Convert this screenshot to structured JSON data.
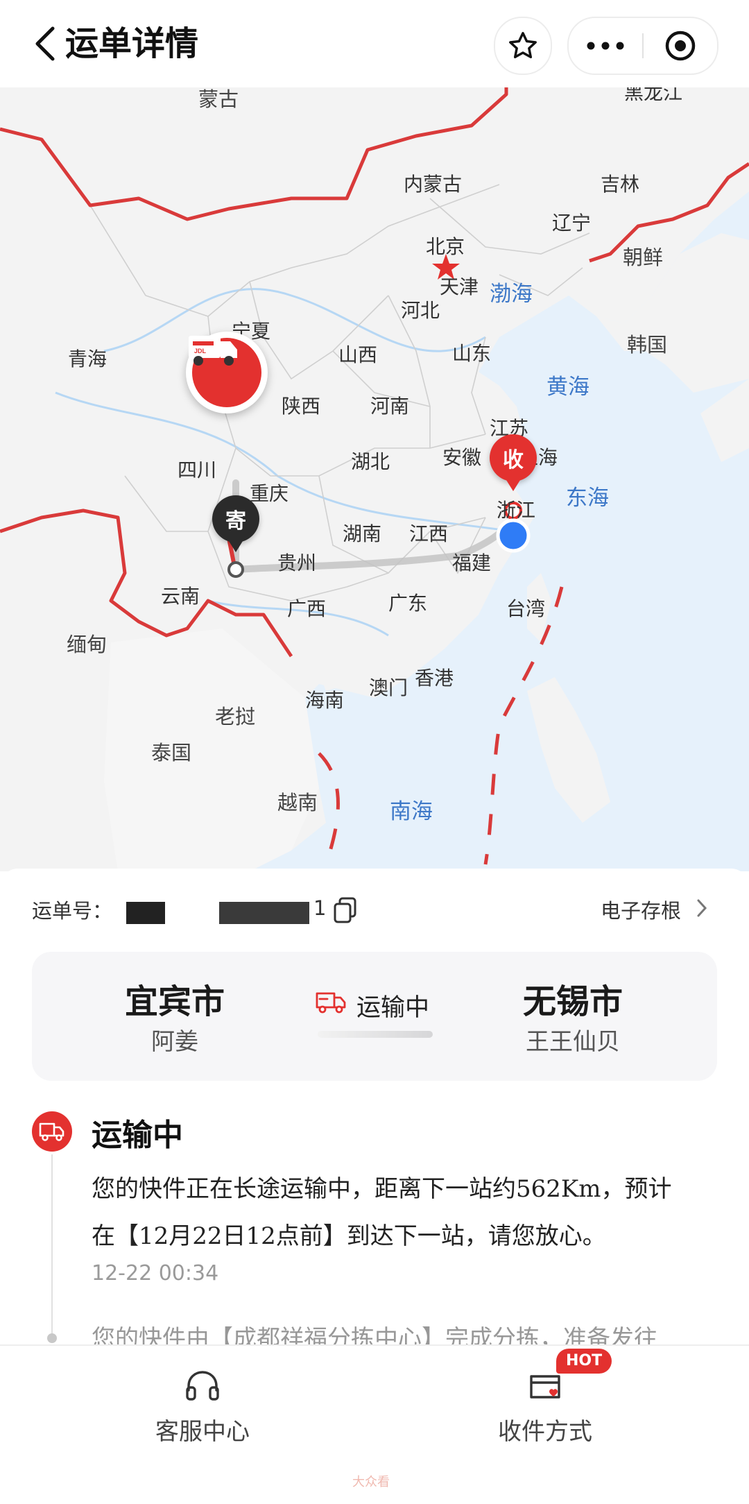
{
  "header": {
    "title": "运单详情",
    "icons": {
      "back": "chevron-left-icon",
      "favorite": "star-icon",
      "more": "more-dots-icon",
      "close": "target-close-icon"
    }
  },
  "map": {
    "provinces": [
      {
        "name": "蒙古",
        "kind": "country"
      },
      {
        "name": "黑龙江",
        "kind": "province"
      },
      {
        "name": "内蒙古",
        "kind": "province"
      },
      {
        "name": "吉林",
        "kind": "province"
      },
      {
        "name": "辽宁",
        "kind": "province"
      },
      {
        "name": "北京",
        "kind": "province"
      },
      {
        "name": "天津",
        "kind": "province"
      },
      {
        "name": "渤海",
        "kind": "sea"
      },
      {
        "name": "朝鲜",
        "kind": "country"
      },
      {
        "name": "宁夏",
        "kind": "province"
      },
      {
        "name": "河北",
        "kind": "province"
      },
      {
        "name": "青海",
        "kind": "province"
      },
      {
        "name": "山西",
        "kind": "province"
      },
      {
        "name": "山东",
        "kind": "province"
      },
      {
        "name": "韩国",
        "kind": "country"
      },
      {
        "name": "黄海",
        "kind": "sea"
      },
      {
        "name": "陕西",
        "kind": "province"
      },
      {
        "name": "河南",
        "kind": "province"
      },
      {
        "name": "江苏",
        "kind": "province"
      },
      {
        "name": "四川",
        "kind": "province"
      },
      {
        "name": "湖北",
        "kind": "province"
      },
      {
        "name": "安徽",
        "kind": "province"
      },
      {
        "name": "上海",
        "kind": "province"
      },
      {
        "name": "重庆",
        "kind": "province"
      },
      {
        "name": "东海",
        "kind": "sea"
      },
      {
        "name": "浙江",
        "kind": "province"
      },
      {
        "name": "湖南",
        "kind": "province"
      },
      {
        "name": "江西",
        "kind": "province"
      },
      {
        "name": "贵州",
        "kind": "province"
      },
      {
        "name": "福建",
        "kind": "province"
      },
      {
        "name": "云南",
        "kind": "province"
      },
      {
        "name": "广西",
        "kind": "province"
      },
      {
        "name": "广东",
        "kind": "province"
      },
      {
        "name": "台湾",
        "kind": "province"
      },
      {
        "name": "缅甸",
        "kind": "country"
      },
      {
        "name": "澳门",
        "kind": "province"
      },
      {
        "name": "香港",
        "kind": "province"
      },
      {
        "name": "海南",
        "kind": "province"
      },
      {
        "name": "老挝",
        "kind": "country"
      },
      {
        "name": "泰国",
        "kind": "country"
      },
      {
        "name": "越南",
        "kind": "country"
      },
      {
        "name": "南海",
        "kind": "sea"
      }
    ],
    "sender_pin": "寄",
    "receiver_pin": "收",
    "truck_brand": "JDL",
    "colors": {
      "water": "#bcdcf7",
      "land": "#f4f4f4",
      "border": "#d93a3a",
      "route": "#b8b8b8",
      "accent": "#e3312f"
    }
  },
  "waybill": {
    "label": "运单号：",
    "number_visible": "1",
    "copy_icon": "copy-icon",
    "ereceipt_label": "电子存根"
  },
  "route": {
    "from_city": "宜宾市",
    "from_person": "阿姜",
    "to_city": "无锡市",
    "to_person": "王王仙贝",
    "status": "运输中"
  },
  "timeline": {
    "current": {
      "title": "运输中",
      "desc_line1": "您的快件正在长途运输中，距离下一站约562Km，预计",
      "desc_line2": "在【12月22日12点前】到达下一站，请您放心。",
      "time": "12-22 00:34"
    },
    "next_preview": "您的快件由【成都祥福分拣中心】完成分拣，准备发往"
  },
  "bottom_bar": {
    "tabs": [
      {
        "label": "客服中心",
        "icon": "headset-icon"
      },
      {
        "label": "收件方式",
        "icon": "delivery-method-icon"
      }
    ],
    "hot_badge": "HOT"
  },
  "watermark": "大众看"
}
